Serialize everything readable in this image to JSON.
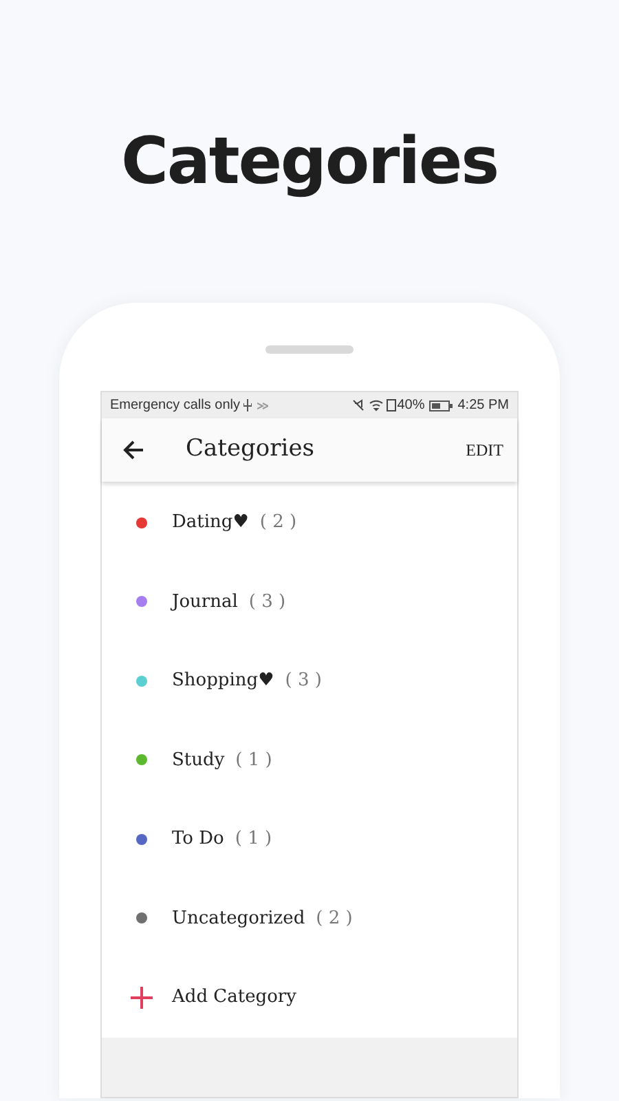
{
  "headline": "Categories",
  "status_bar": {
    "carrier": "Emergency calls only",
    "battery": "40%",
    "time": "4:25 PM"
  },
  "app_bar": {
    "title": "Categories",
    "action": "EDIT"
  },
  "categories": [
    {
      "name": "Dating♥",
      "count": "( 2 )",
      "color": "#e53935"
    },
    {
      "name": "Journal",
      "count": "( 3 )",
      "color": "#a57ff0"
    },
    {
      "name": "Shopping♥",
      "count": "( 3 )",
      "color": "#5ccfd2"
    },
    {
      "name": "Study",
      "count": "( 1 )",
      "color": "#5cb82e"
    },
    {
      "name": "To Do",
      "count": "( 1 )",
      "color": "#5468c4"
    },
    {
      "name": "Uncategorized",
      "count": "( 2 )",
      "color": "#707070"
    }
  ],
  "add_button": {
    "label": "Add Category"
  }
}
